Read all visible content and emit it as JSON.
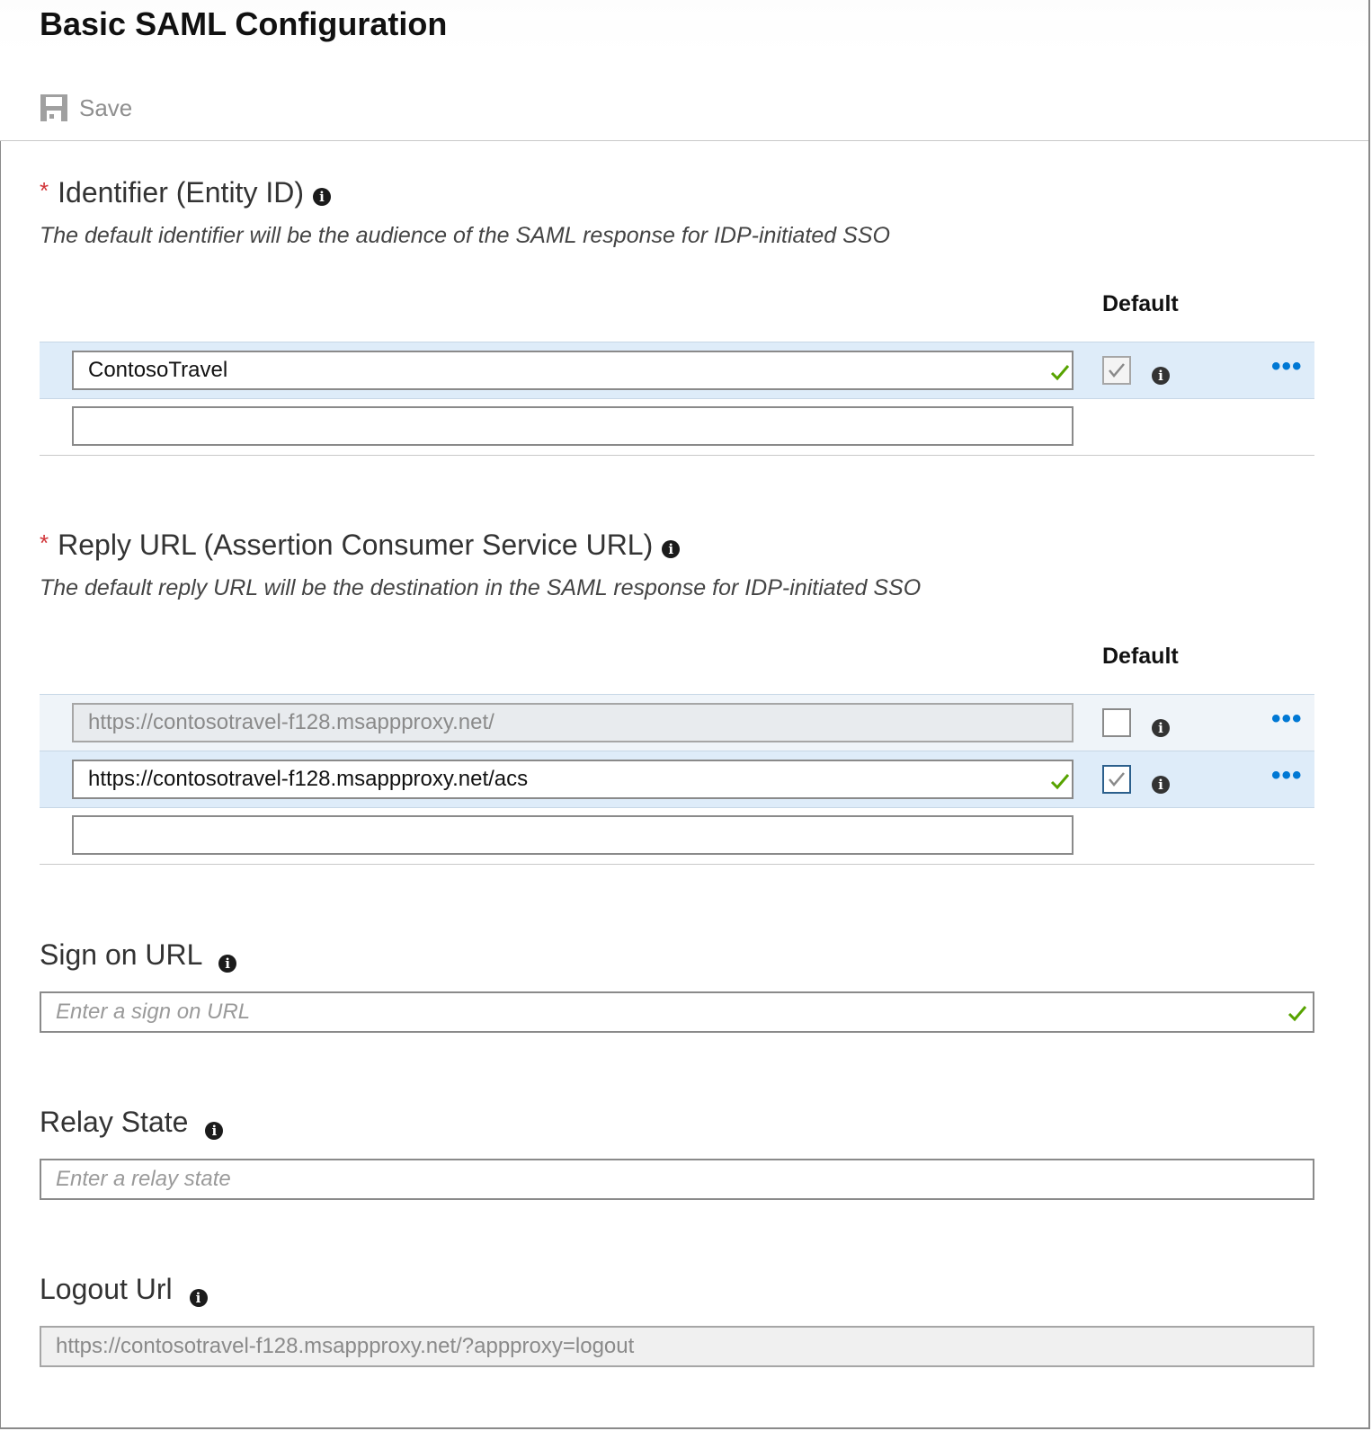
{
  "title": "Basic SAML Configuration",
  "toolbar": {
    "save_label": "Save"
  },
  "identifier": {
    "required_mark": "*",
    "label": "Identifier (Entity ID)",
    "description": "The default identifier will be the audience of the SAML response for IDP-initiated SSO",
    "default_header": "Default",
    "rows": [
      {
        "value": "ContosoTravel",
        "default": true,
        "valid": true
      },
      {
        "value": ""
      }
    ]
  },
  "reply_url": {
    "required_mark": "*",
    "label": "Reply URL (Assertion Consumer Service URL)",
    "description": "The default reply URL will be the destination in the SAML response for IDP-initiated SSO",
    "default_header": "Default",
    "rows": [
      {
        "value": "https://contosotravel-f128.msappproxy.net/",
        "default": false,
        "disabled": true
      },
      {
        "value": "https://contosotravel-f128.msappproxy.net/acs",
        "default": true,
        "valid": true
      },
      {
        "value": ""
      }
    ]
  },
  "sign_on": {
    "label": "Sign on URL",
    "placeholder": "Enter a sign on URL",
    "valid": true
  },
  "relay_state": {
    "label": "Relay State",
    "placeholder": "Enter a relay state"
  },
  "logout": {
    "label": "Logout Url",
    "value": "https://contosotravel-f128.msappproxy.net/?appproxy=logout"
  },
  "icons": {
    "info": "i",
    "more": "•••"
  },
  "colors": {
    "accent": "#0078d4",
    "required": "#d13438",
    "valid": "#57a300",
    "selected_row": "#deecf9"
  }
}
